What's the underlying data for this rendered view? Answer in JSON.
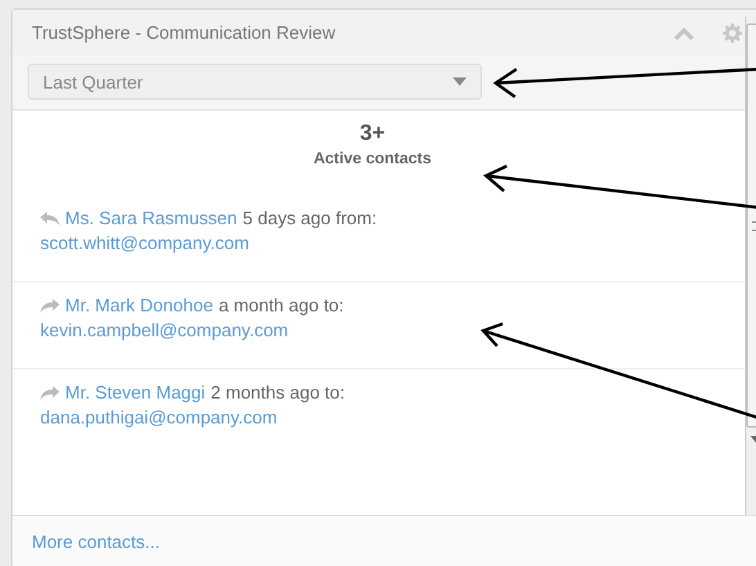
{
  "panel": {
    "title": "TrustSphere - Communication Review"
  },
  "period_select": {
    "value": "Last Quarter"
  },
  "summary": {
    "count": "3+",
    "label": "Active contacts"
  },
  "contacts": [
    {
      "kind": "received",
      "name": "Ms. Sara Rasmussen",
      "detail": "5 days ago from:",
      "email": "scott.whitt@company.com"
    },
    {
      "kind": "sent",
      "name": "Mr. Mark Donohoe",
      "detail": "a month ago to:",
      "email": "kevin.campbell@company.com"
    },
    {
      "kind": "sent",
      "name": "Mr. Steven Maggi",
      "detail": "2 months ago to:",
      "email": "dana.puthigai@company.com"
    }
  ],
  "footer": {
    "link": "More contacts..."
  }
}
